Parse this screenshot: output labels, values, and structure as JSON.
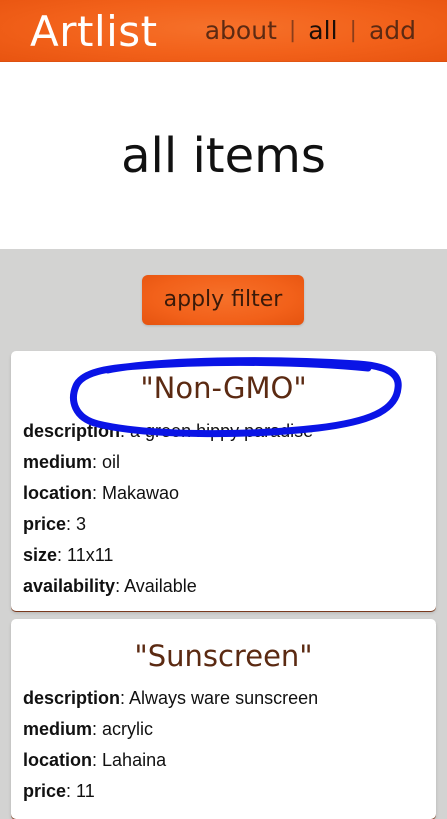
{
  "navbar": {
    "brand": "Artlist",
    "links": [
      {
        "label": "about",
        "active": false
      },
      {
        "label": "all",
        "active": true
      },
      {
        "label": "add",
        "active": false
      }
    ],
    "separator": "|"
  },
  "page": {
    "title": "all items"
  },
  "filter": {
    "button_label": "apply filter"
  },
  "items": [
    {
      "title": "\"Non-GMO\"",
      "fields": [
        {
          "key": "description",
          "value": "a green hippy paradise"
        },
        {
          "key": "medium",
          "value": "oil"
        },
        {
          "key": "location",
          "value": "Makawao"
        },
        {
          "key": "price",
          "value": "3"
        },
        {
          "key": "size",
          "value": "11x11"
        },
        {
          "key": "availability",
          "value": "Available"
        }
      ]
    },
    {
      "title": "\"Sunscreen\"",
      "fields": [
        {
          "key": "description",
          "value": "Always ware sunscreen"
        },
        {
          "key": "medium",
          "value": "acrylic"
        },
        {
          "key": "location",
          "value": "Lahaina"
        },
        {
          "key": "price",
          "value": "11"
        }
      ]
    }
  ],
  "colors": {
    "brand_orange": "#f2611a",
    "title_brown": "#5b2a12",
    "annotation_blue": "#0a14e6",
    "background_gray": "#d3d3d2"
  }
}
